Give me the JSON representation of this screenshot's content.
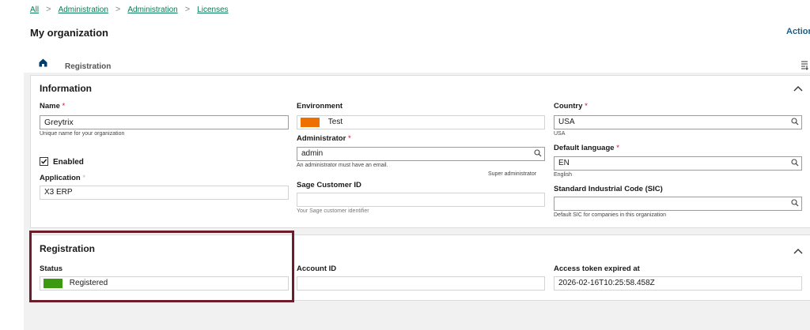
{
  "breadcrumb": {
    "items": [
      "All",
      "Administration",
      "Administration",
      "Licenses"
    ],
    "separator": ">"
  },
  "page": {
    "title": "My organization",
    "actions_label": "Actions"
  },
  "tabs": {
    "registration_label": "Registration"
  },
  "information": {
    "title": "Information",
    "name": {
      "label": "Name",
      "required_mark": "*",
      "value": "Greytrix",
      "help": "Unique name for your organization"
    },
    "enabled": {
      "label": "Enabled",
      "checked": true
    },
    "application": {
      "label": "Application",
      "required_mark": "*",
      "value": "X3 ERP"
    },
    "environment": {
      "label": "Environment",
      "value": "Test",
      "color": "#ee6f00"
    },
    "administrator": {
      "label": "Administrator",
      "required_mark": "*",
      "value": "admin",
      "help": "An administrator must have an email.",
      "role_hint": "Super administrator"
    },
    "sage_customer_id": {
      "label": "Sage Customer ID",
      "value": "",
      "help": "Your Sage customer identifier"
    },
    "country": {
      "label": "Country",
      "required_mark": "*",
      "value": "USA",
      "help": "USA"
    },
    "default_language": {
      "label": "Default language",
      "required_mark": "*",
      "value": "EN",
      "help": "English"
    },
    "sic": {
      "label": "Standard Industrial Code (SIC)",
      "value": "",
      "help": "Default SIC for companies in this organization"
    }
  },
  "registration": {
    "title": "Registration",
    "status": {
      "label": "Status",
      "value": "Registered",
      "color": "#3b9a12"
    },
    "account_id": {
      "label": "Account ID",
      "value": ""
    },
    "access_token": {
      "label": "Access token expired at",
      "value": "2026-02-16T10:25:58.458Z"
    }
  },
  "colors": {
    "link": "#0a7a55",
    "required": "#c8102e",
    "tab_underline": "#003d6b",
    "highlight_border": "#6d1d2a"
  }
}
